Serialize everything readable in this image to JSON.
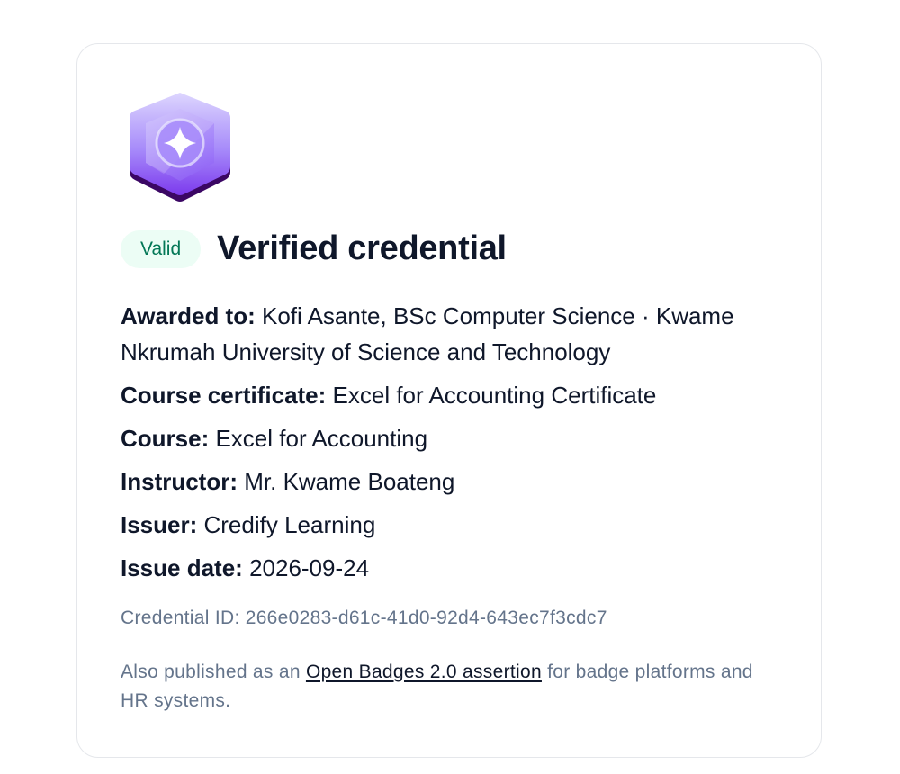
{
  "badge": {
    "icon": "sparkle-hexagon-badge-icon",
    "colors": {
      "top": "#c4b5fd",
      "bottom": "#7c3aed",
      "edge": "#3b0764"
    }
  },
  "status": {
    "label": "Valid",
    "color": "#047857",
    "background": "#ecfdf5"
  },
  "title": "Verified credential",
  "fields": {
    "awarded_to": {
      "label": "Awarded to:",
      "value": "Kofi Asante, BSc Computer Science · Kwame Nkrumah University of Science and Technology"
    },
    "course_certificate": {
      "label": "Course certificate:",
      "value": "Excel for Accounting Certificate"
    },
    "course": {
      "label": "Course:",
      "value": "Excel for Accounting"
    },
    "instructor": {
      "label": "Instructor:",
      "value": "Mr. Kwame Boateng"
    },
    "issuer": {
      "label": "Issuer:",
      "value": "Credify Learning"
    },
    "issue_date": {
      "label": "Issue date:",
      "value": "2026-09-24"
    }
  },
  "credential_id": "Credential ID: 266e0283-d61c-41d0-92d4-643ec7f3cdc7",
  "note": {
    "prefix": "Also published as an ",
    "link": "Open Badges 2.0 assertion",
    "suffix": " for badge platforms and HR systems."
  }
}
